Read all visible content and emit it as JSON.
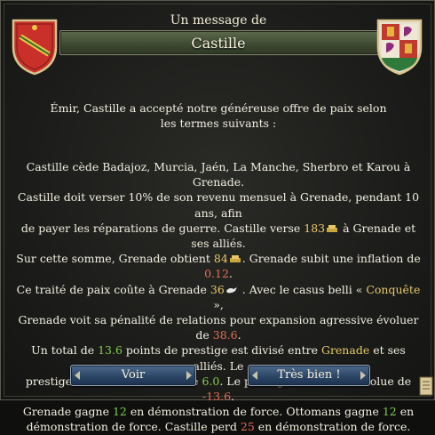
{
  "dialog": {
    "subtitle": "Un message de",
    "title": "Castille",
    "intro_line1": "Émir, Castille a accepté notre généreuse offre de paix selon",
    "intro_line2": "les termes suivants :",
    "body": {
      "l1": "Castille cède Badajoz, Murcia, Jaén, La Manche, Sherbro et Karou à Grenade.",
      "l2": "Castille doit verser 10% de son revenu mensuel à Grenade, pendant 10 ans, afin",
      "l3a": "de payer les réparations de guerre. Castille verse ",
      "gold1": "183",
      "l3b": " à Grenade et ses alliés.",
      "l4a": "Sur cette somme, Grenade obtient ",
      "gold2": "84",
      "l4b": ". Grenade subit une inflation de ",
      "inflation": "0.12",
      "l4c": ".",
      "l5a": "Ce traité de paix coûte à Grenade ",
      "peace_cost": "36",
      "l5b": " . Avec le casus belli « ",
      "casus": "Conquête",
      "l5c": " »,",
      "l6a": "Grenade voit sa pénalité de relations pour expansion agressive évoluer de ",
      "ae": "38.6",
      "l6b": ".",
      "l7a": "Un total de ",
      "prestige_total": "13.6",
      "l7b": " points de prestige est divisé entre ",
      "grenade": "Grenade",
      "l7c": " et ses alliés. Le",
      "l8a": "prestige de Grenade évolue de ",
      "prestige_gain": "6.0",
      "l8b": ". Le prestige de Castille évolue de ",
      "prestige_loss": "-13.6",
      "l8c": ".",
      "l9a": "Grenade gagne ",
      "pf1": "12",
      "l9b": " en démonstration de force. Ottomans gagne ",
      "pf2": "12",
      "l9c": " en",
      "l10a": "démonstration de force. Castille perd ",
      "pf3": "25",
      "l10b": " en démonstration de force."
    },
    "buttons": {
      "voir": "Voir",
      "ok": "Très bien !"
    }
  },
  "colors": {
    "positive": "#7fcd4a",
    "negative": "#e06c55",
    "highlight": "#e8c86a",
    "text": "#f3efe1"
  },
  "icons": [
    "granada-shield-icon",
    "castile-shield-icon",
    "gold-icon",
    "peace-dove-icon",
    "scroll-icon"
  ]
}
